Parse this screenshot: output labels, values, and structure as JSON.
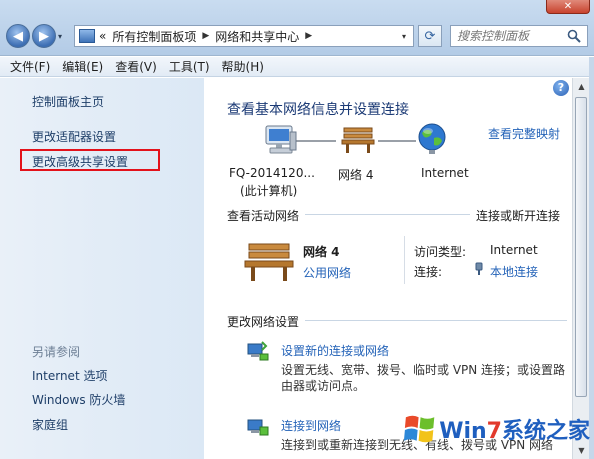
{
  "window": {
    "close_glyph": "✕"
  },
  "nav": {
    "back_glyph": "◀",
    "forward_glyph": "▶",
    "dropdown_glyph": "▾"
  },
  "address": {
    "prefix": "«",
    "crumbs": [
      "所有控制面板项",
      "网络和共享中心"
    ],
    "separator": "▶",
    "dropdown_glyph": "▾"
  },
  "refresh_glyph": "⟳",
  "search": {
    "placeholder": "搜索控制面板",
    "icon": "search-icon"
  },
  "menu": [
    "文件(F)",
    "编辑(E)",
    "查看(V)",
    "工具(T)",
    "帮助(H)"
  ],
  "sidebar": {
    "home": "控制面板主页",
    "links": [
      "更改适配器设置",
      "更改高级共享设置"
    ],
    "see_also_title": "另请参阅",
    "see_also": [
      "Internet 选项",
      "Windows 防火墙",
      "家庭组"
    ]
  },
  "main": {
    "help_glyph": "?",
    "title": "查看基本网络信息并设置连接",
    "view_full_map": "查看完整映射",
    "map": {
      "computer_label": "FQ-2014120...",
      "computer_sub": "(此计算机)",
      "network_label": "网络  4",
      "internet_label": "Internet"
    },
    "active_header": "查看活动网络",
    "connect_disconnect": "连接或断开连接",
    "network": {
      "name": "网络  4",
      "type": "公用网络",
      "access_type_label": "访问类型:",
      "access_type_value": "Internet",
      "connections_label": "连接:",
      "connections_value": "本地连接"
    },
    "change_header": "更改网络设置",
    "tasks": [
      {
        "title": "设置新的连接或网络",
        "desc": "设置无线、宽带、拨号、临时或 VPN 连接；或设置路由器或访问点。"
      },
      {
        "title": "连接到网络",
        "desc": "连接到或重新连接到无线、有线、拨号或 VPN 网络"
      }
    ]
  },
  "scrollbar": {
    "up_glyph": "▲",
    "down_glyph": "▼"
  },
  "watermark": {
    "prefix": "Win",
    "seven": "7",
    "suffix": "系统之家"
  },
  "colors": {
    "highlight": "#e3121b",
    "link": "#2463b8",
    "title": "#1b3a75"
  }
}
